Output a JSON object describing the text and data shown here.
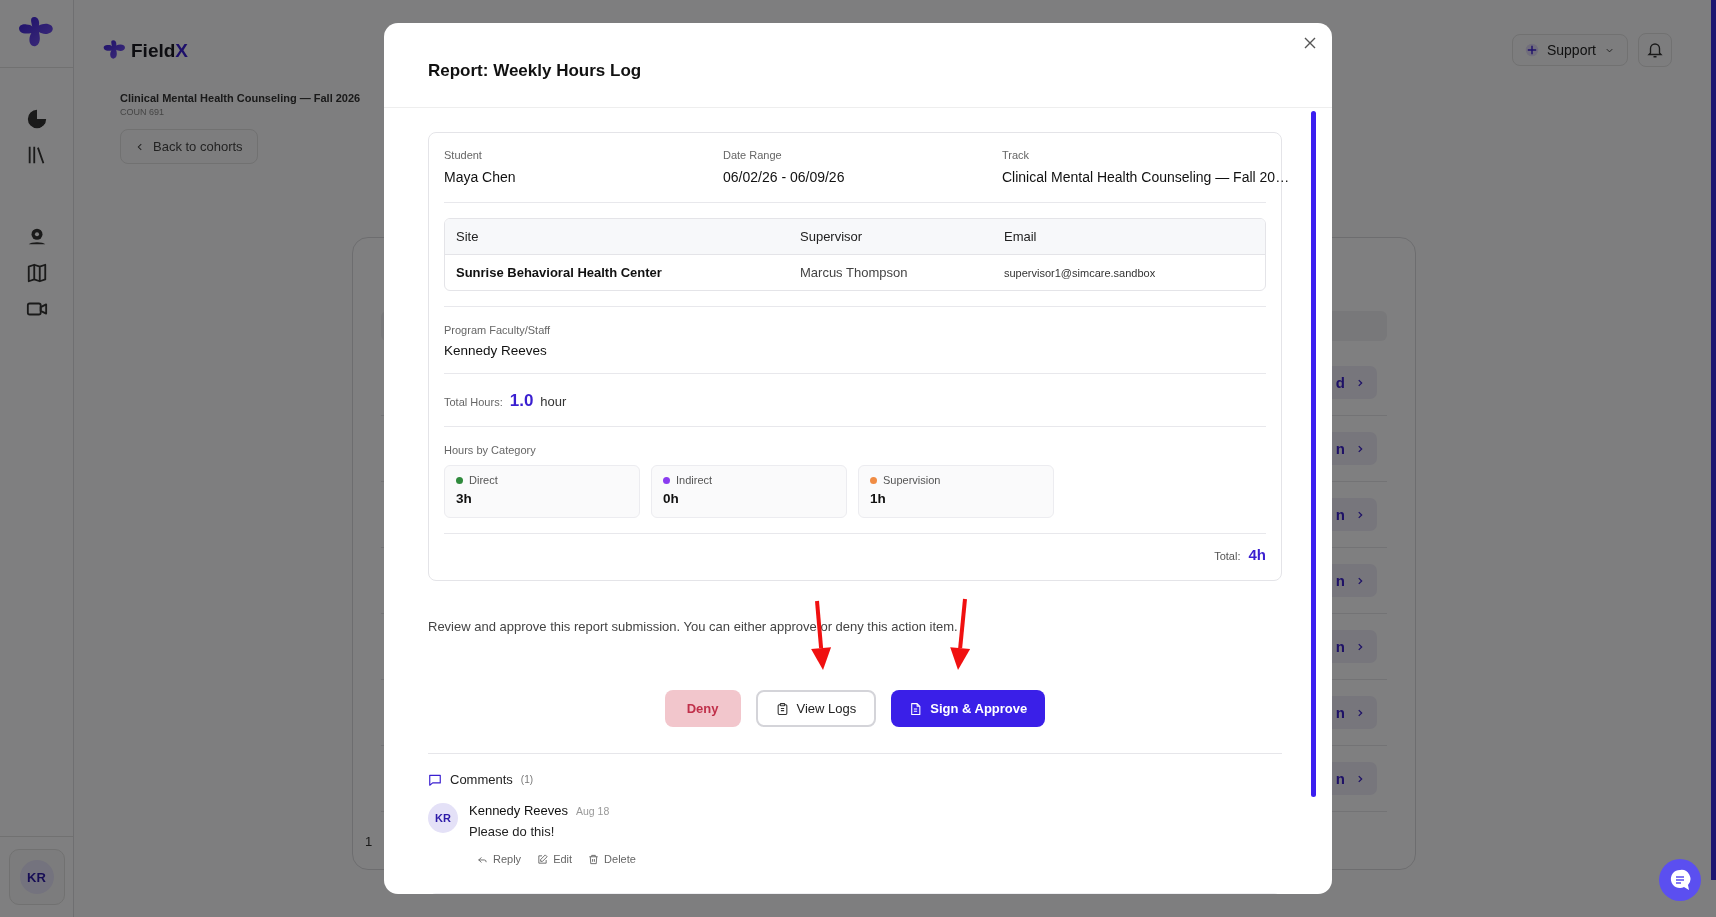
{
  "sidebar": {
    "avatar": "KR"
  },
  "header": {
    "brand": {
      "text": "Field",
      "accent": "X"
    },
    "support": "Support"
  },
  "course": {
    "title": "Clinical Mental Health Counseling — Fall 2026",
    "code": "COUN 691"
  },
  "back_button": "Back to cohorts",
  "background_rows": [
    {
      "action": "d"
    },
    {
      "action": "n"
    },
    {
      "action": "n"
    },
    {
      "action": "n"
    },
    {
      "action": "n"
    },
    {
      "action": "n"
    },
    {
      "action": "n"
    }
  ],
  "pagination": "1",
  "modal": {
    "title": "Report: Weekly Hours Log",
    "summary": [
      {
        "label": "Student",
        "value": "Maya Chen"
      },
      {
        "label": "Date Range",
        "value": "06/02/26 - 06/09/26"
      },
      {
        "label": "Track",
        "value": "Clinical Mental Health Counseling — Fall 20…"
      }
    ],
    "site_table": {
      "columns": [
        "Site",
        "Supervisor",
        "Email"
      ],
      "rows": [
        [
          "Sunrise Behavioral Health Center",
          "Marcus Thompson",
          "supervisor1@simcare.sandbox"
        ]
      ]
    },
    "faculty": {
      "label": "Program Faculty/Staff",
      "value": "Kennedy Reeves"
    },
    "total_hours": {
      "label": "Total Hours:",
      "value": "1.0",
      "unit": "hour"
    },
    "categories": {
      "title": "Hours by Category",
      "items": [
        {
          "name": "Direct",
          "value": "3h",
          "color": "#2f8a3c"
        },
        {
          "name": "Indirect",
          "value": "0h",
          "color": "#8a3cf0"
        },
        {
          "name": "Supervision",
          "value": "1h",
          "color": "#f08c44"
        }
      ]
    },
    "total": {
      "label": "Total:",
      "value": "4h"
    },
    "description": "Review and approve this report submission. You can either approve or deny this action item.",
    "buttons": [
      {
        "kind": "deny",
        "label": "Deny"
      },
      {
        "kind": "secondary",
        "label": "View Logs"
      },
      {
        "kind": "primary",
        "label": "Sign & Approve"
      }
    ],
    "comments": {
      "title": "Comments",
      "count": "(1)",
      "items": [
        {
          "avatar": "KR",
          "author": "Kennedy Reeves",
          "date": "Aug 18",
          "text": "Please do this!",
          "actions": [
            {
              "kind": "reply",
              "label": "Reply"
            },
            {
              "kind": "edit",
              "label": "Edit"
            },
            {
              "kind": "delete",
              "label": "Delete"
            }
          ]
        }
      ]
    }
  }
}
